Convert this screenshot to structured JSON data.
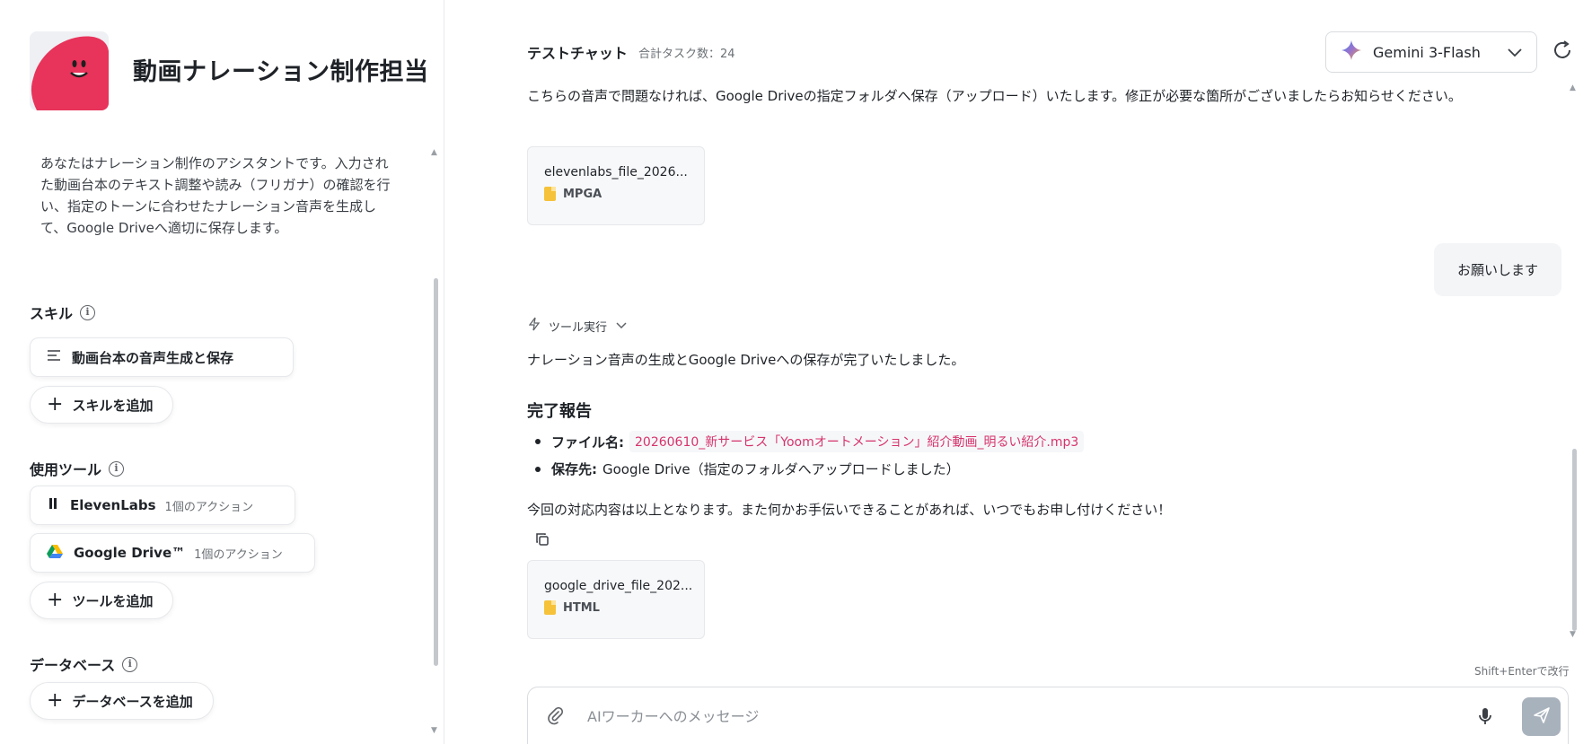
{
  "sidebar": {
    "agent_name": "動画ナレーション制作担当",
    "description": "あなたはナレーション制作のアシスタントです。入力された動画台本のテキスト調整や読み（フリガナ）の確認を行い、指定のトーンに合わせたナレーション音声を生成して、Google Driveへ適切に保存します。",
    "skills": {
      "title": "スキル",
      "items": [
        {
          "label": "動画台本の音声生成と保存",
          "icon": "list-icon"
        }
      ],
      "add_label": "スキルを追加"
    },
    "tools": {
      "title": "使用ツール",
      "items": [
        {
          "label": "ElevenLabs",
          "sub": "1個のアクション",
          "icon": "elevenlabs-icon"
        },
        {
          "label": "Google Drive™",
          "sub": "1個のアクション",
          "icon": "google-drive-icon"
        }
      ],
      "add_label": "ツールを追加"
    },
    "database": {
      "title": "データベース",
      "add_label": "データベースを追加"
    }
  },
  "header": {
    "chat_title": "テストチャット",
    "task_count": "合計タスク数：24",
    "model": "Gemini 3-Flash"
  },
  "messages": {
    "intro_text": "こちらの音声で問題なければ、Google Driveの指定フォルダへ保存（アップロード）いたします。修正が必要な箇所がございましたらお知らせください。",
    "file1": {
      "name": "elevenlabs_file_2026...",
      "type": "MPGA"
    },
    "user_message": "お願いします",
    "tool_run_label": "ツール実行",
    "result_text": "ナレーション音声の生成とGoogle Driveへの保存が完了いたしました。",
    "report_title": "完了報告",
    "bullets": [
      {
        "label": "ファイル名:",
        "value": "20260610_新サービス「Yoomオートメーション」紹介動画_明るい紹介.mp3"
      },
      {
        "label": "保存先:",
        "value": "Google Drive（指定のフォルダへアップロードしました）"
      }
    ],
    "closing_text": "今回の対応内容は以上となります。また何かお手伝いできることがあれば、いつでもお申し付けください！",
    "file2": {
      "name": "google_drive_file_202...",
      "type": "HTML"
    }
  },
  "composer": {
    "hint": "Shift+Enterで改行",
    "placeholder": "AIワーカーへのメッセージ",
    "value": ""
  },
  "colors": {
    "avatar_red": "#e8335a",
    "code_pink": "#d6336c",
    "send_gray": "#a8b2bd",
    "file_yellow": "#f5c23a"
  }
}
